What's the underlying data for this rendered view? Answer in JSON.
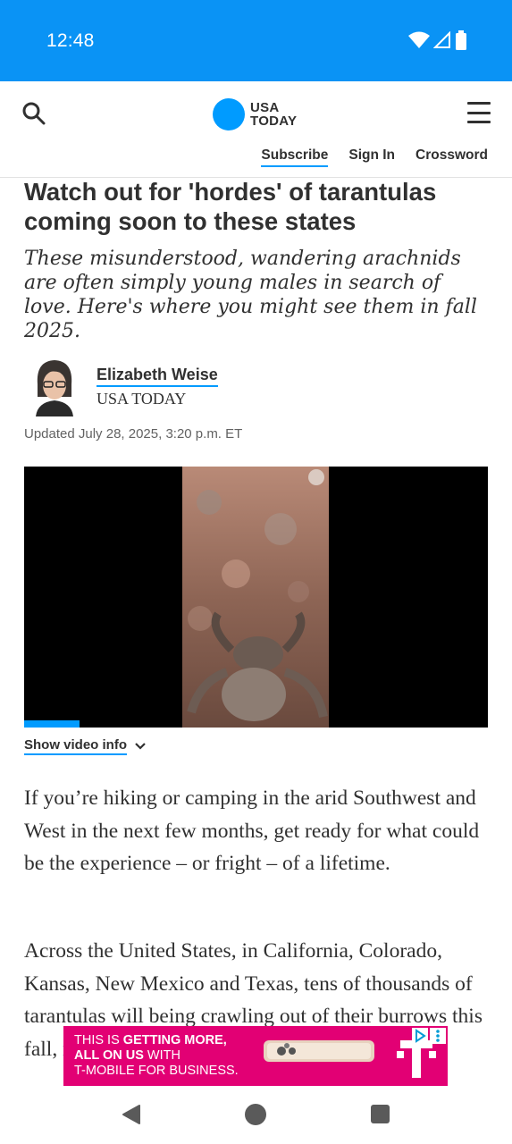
{
  "status_bar": {
    "time": "12:48"
  },
  "header": {
    "logo_line1": "USA",
    "logo_line2": "TODAY",
    "links": {
      "subscribe": "Subscribe",
      "sign_in": "Sign In",
      "crossword": "Crossword"
    }
  },
  "article": {
    "headline": "Watch out for 'hordes' of tarantulas coming soon to these states",
    "subhead": "These misunderstood, wandering arachnids are often simply young males in search of love. Here's where you might see them in fall 2025.",
    "author": {
      "name": "Elizabeth Weise",
      "org": "USA TODAY"
    },
    "updated": "Updated July 28, 2025, 3:20 p.m. ET",
    "video": {
      "info_label": "Show video info",
      "progress": 0.12
    },
    "paragraphs": [
      "If you’re hiking or camping in the arid Southwest and West in the next few months, get ready for what could be the experience – or fright – of a lifetime.",
      "Across the United States, in California, Colorado, Kansas, New Mexico and Texas, tens of thousands of tarantulas will being crawling out of their burrows this fall, ready to make"
    ]
  },
  "ad": {
    "line1_plain": "THIS IS ",
    "line1_bold": "GETTING MORE,",
    "line2_bold": "ALL ON US",
    "line2_plain": " WITH",
    "line3": "T-MOBILE FOR BUSINESS.",
    "brand_color": "#e20074"
  },
  "colors": {
    "accent": "#009bff",
    "status_bar": "#0a93f5"
  }
}
